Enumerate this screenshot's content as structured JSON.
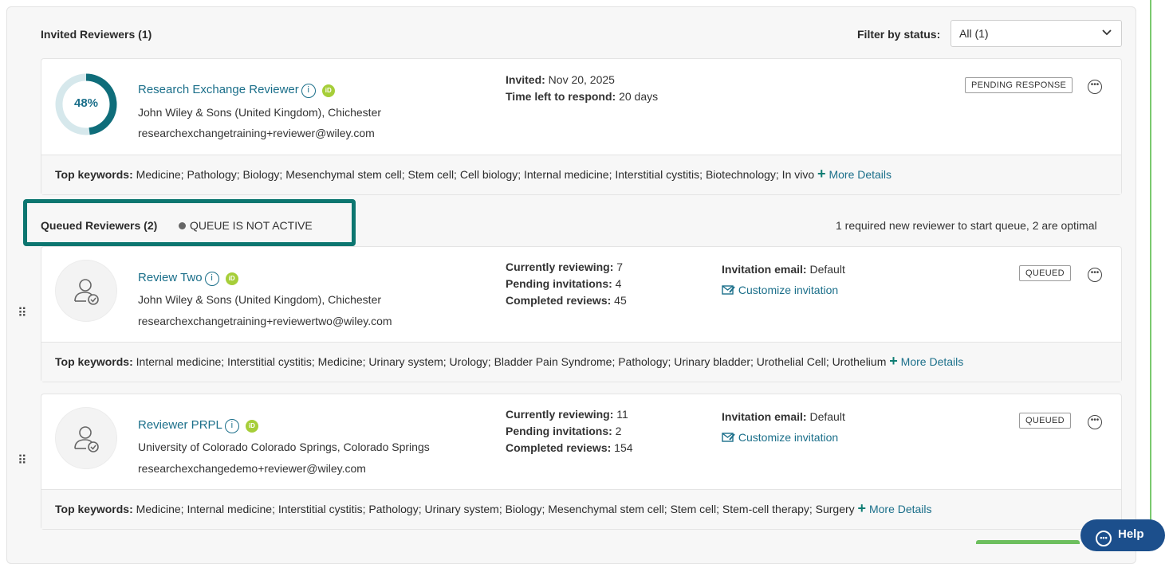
{
  "invited": {
    "title": "Invited Reviewers (1)",
    "filter_label": "Filter by status:",
    "filter_value": "All (1)",
    "reviewer": {
      "score": "48%",
      "score_fraction": 0.48,
      "name": "Research Exchange Reviewer",
      "affiliation": "John Wiley & Sons (United Kingdom), Chichester",
      "email": "researchexchangetraining+reviewer@wiley.com",
      "invited_label": "Invited:",
      "invited_value": "Nov 20, 2025",
      "time_left_label": "Time left to respond:",
      "time_left_value": "20 days",
      "status": "PENDING RESPONSE",
      "keywords_label": "Top keywords:",
      "keywords": "Medicine; Pathology; Biology; Mesenchymal stem cell; Stem cell; Cell biology; Internal medicine; Interstitial cystitis; Biotechnology; In vivo",
      "more_details": "More Details"
    }
  },
  "queued": {
    "title": "Queued Reviewers (2)",
    "queue_status": "QUEUE IS NOT ACTIVE",
    "queue_note": "1 required new reviewer to start queue, 2 are optimal",
    "reviewers": [
      {
        "name": "Review Two",
        "affiliation": "John Wiley & Sons (United Kingdom), Chichester",
        "email": "researchexchangetraining+reviewertwo@wiley.com",
        "currently_label": "Currently reviewing:",
        "currently_value": "7",
        "pending_label": "Pending invitations:",
        "pending_value": "4",
        "completed_label": "Completed reviews:",
        "completed_value": "45",
        "invitation_label": "Invitation email:",
        "invitation_value": "Default",
        "customize": "Customize invitation",
        "status": "QUEUED",
        "keywords_label": "Top keywords:",
        "keywords": "Internal medicine; Interstitial cystitis; Medicine; Urinary system; Urology; Bladder Pain Syndrome; Pathology; Urinary bladder; Urothelial Cell; Urothelium",
        "more_details": "More Details"
      },
      {
        "name": "Reviewer PRPL",
        "affiliation": "University of Colorado Colorado Springs, Colorado Springs",
        "email": "researchexchangedemo+reviewer@wiley.com",
        "currently_label": "Currently reviewing:",
        "currently_value": "11",
        "pending_label": "Pending invitations:",
        "pending_value": "2",
        "completed_label": "Completed reviews:",
        "completed_value": "154",
        "invitation_label": "Invitation email:",
        "invitation_value": "Default",
        "customize": "Customize invitation",
        "status": "QUEUED",
        "keywords_label": "Top keywords:",
        "keywords": "Medicine; Internal medicine; Interstitial cystitis; Pathology; Urinary system; Biology; Mesenchymal stem cell; Stem cell; Stem-cell therapy; Surgery",
        "more_details": "More Details"
      }
    ]
  },
  "help": {
    "label": "Help"
  },
  "colors": {
    "accent": "#0c7670",
    "link": "#1b6f8a",
    "help": "#1c4f8c",
    "orcid": "#a6ce39"
  }
}
